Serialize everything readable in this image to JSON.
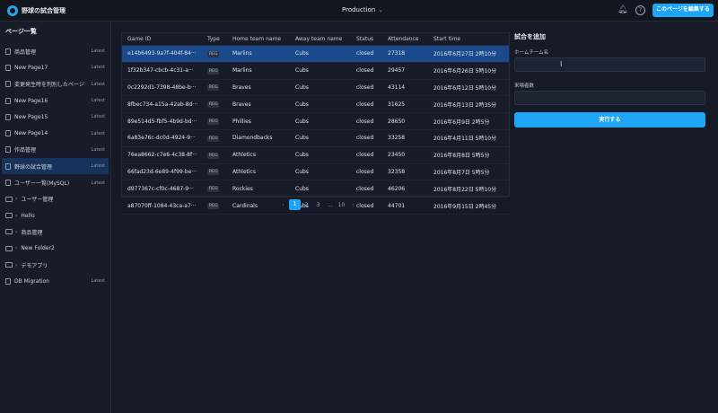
{
  "header": {
    "app_title": "野球の試合管理",
    "environment": "Production",
    "help_symbol": "?",
    "publish_label": "このページを編集する"
  },
  "sidebar": {
    "title": "ページ一覧",
    "items": [
      {
        "label": "商品管理",
        "tag": "Latest",
        "kind": "page"
      },
      {
        "label": "New Page17",
        "tag": "Latest",
        "kind": "page"
      },
      {
        "label": "変更発生時を判別したページ",
        "tag": "Latest",
        "kind": "page"
      },
      {
        "label": "New Page16",
        "tag": "Latest",
        "kind": "page"
      },
      {
        "label": "New Page15",
        "tag": "Latest",
        "kind": "page"
      },
      {
        "label": "New Page14",
        "tag": "Latest",
        "kind": "page"
      },
      {
        "label": "作品管理",
        "tag": "Latest",
        "kind": "page"
      },
      {
        "label": "野球の試合管理",
        "tag": "Latest",
        "kind": "page",
        "active": true
      },
      {
        "label": "ユーザー一覧(MySQL)",
        "tag": "Latest",
        "kind": "page"
      },
      {
        "label": "ユーザー管理",
        "tag": "",
        "kind": "folder"
      },
      {
        "label": "Hello",
        "tag": "",
        "kind": "folder"
      },
      {
        "label": "商品管理",
        "tag": "",
        "kind": "folder"
      },
      {
        "label": "New Folder2",
        "tag": "",
        "kind": "folder"
      },
      {
        "label": "デモアプリ",
        "tag": "",
        "kind": "folder"
      },
      {
        "label": "DB Migration",
        "tag": "Latest",
        "kind": "page"
      }
    ]
  },
  "table": {
    "columns": [
      "Game ID",
      "Type",
      "Home team name",
      "Away team name",
      "Status",
      "Attendance",
      "Start time"
    ],
    "rows": [
      [
        "e14b6493-9a7f-404f-84···",
        "REG",
        "Marlins",
        "Cubs",
        "closed",
        "27318",
        "2016年6月27日 2時10分"
      ],
      [
        "1f32b347-cbcb-4c31-a···",
        "REG",
        "Marlins",
        "Cubs",
        "closed",
        "29457",
        "2016年6月26日 5時10分"
      ],
      [
        "0c2292d1-7398-48be-b···",
        "REG",
        "Braves",
        "Cubs",
        "closed",
        "43114",
        "2016年6月12日 5時10分"
      ],
      [
        "8fbec734-a15a-42ab-8d···",
        "REG",
        "Braves",
        "Cubs",
        "closed",
        "31625",
        "2016年6月13日 2時35分"
      ],
      [
        "89e514d5-fbf5-4b9d-bd···",
        "REG",
        "Phillies",
        "Cubs",
        "closed",
        "28650",
        "2016年6月9日 2時5分"
      ],
      [
        "6a83e76c-dc0d-4924-9···",
        "REG",
        "Diamondbacks",
        "Cubs",
        "closed",
        "33258",
        "2016年4月11日 5時10分"
      ],
      [
        "76ea8662-c7e6-4c38-8f···",
        "REG",
        "Athletics",
        "Cubs",
        "closed",
        "23450",
        "2016年8月8日 5時5分"
      ],
      [
        "66fad23d-6e89-4f99-be···",
        "REG",
        "Athletics",
        "Cubs",
        "closed",
        "32358",
        "2016年8月7日 5時5分"
      ],
      [
        "d977367c-cf0c-4687-9···",
        "REG",
        "Rockies",
        "Cubs",
        "closed",
        "46206",
        "2016年8月22日 5時10分"
      ],
      [
        "a87070ff-1084-43ca-a7···",
        "REG",
        "Cardinals",
        "Cubs",
        "closed",
        "44701",
        "2016年9月15日 2時45分"
      ]
    ],
    "selected_row": 0
  },
  "pagination": {
    "prev": "‹",
    "pages": [
      "1",
      "2",
      "3",
      "10"
    ],
    "ellipsis": "…",
    "current": "1",
    "next": "›"
  },
  "form": {
    "title": "試合を追加",
    "home_team_label": "ホームチーム名",
    "home_team_value": "",
    "attendance_label": "来場者数",
    "attendance_value": "",
    "submit_label": "実行する"
  },
  "colors": {
    "accent": "#1ea5f5",
    "selected_row": "#1a4a8c",
    "background": "#151a26"
  }
}
